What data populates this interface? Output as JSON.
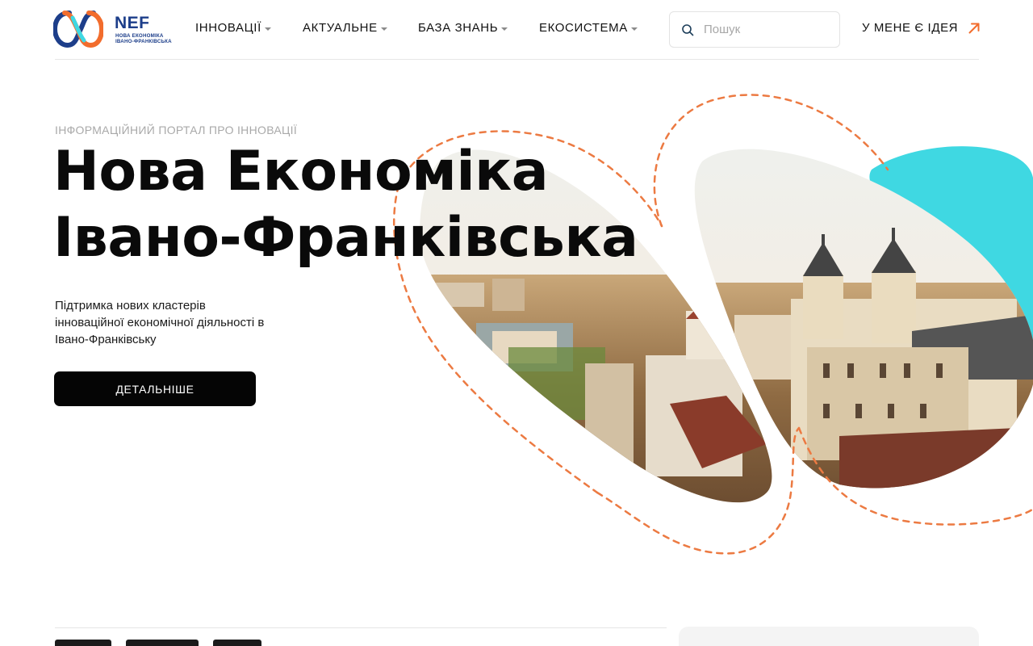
{
  "header": {
    "logo": {
      "brand": "NEF",
      "subtitle_line1": "НОВА ЕКОНОМІКА",
      "subtitle_line2": "ІВАНО-ФРАНКІВСЬКА"
    },
    "nav": [
      {
        "label": "ІННОВАЦІЇ",
        "has_dropdown": true
      },
      {
        "label": "АКТУАЛЬНЕ",
        "has_dropdown": true
      },
      {
        "label": "БАЗА ЗНАНЬ",
        "has_dropdown": true
      },
      {
        "label": "ЕКОСИСТЕМА",
        "has_dropdown": true
      }
    ],
    "search": {
      "placeholder": "Пошук",
      "value": "",
      "icon": "search-icon"
    },
    "idea_link": {
      "label": "У МЕНЕ Є ІДЕЯ",
      "icon": "arrow-up-right-icon"
    }
  },
  "hero": {
    "eyebrow": "ІНФОРМАЦІЙНИЙ ПОРТАЛ ПРО ІННОВАЦІЇ",
    "title_line1": "Нова Економіка",
    "title_line2": "Івано-Франківська",
    "lead": "Підтримка нових кластерів інноваційної економічної діяльності в Івано-Франківську",
    "cta_label": "ДЕТАЛЬНІШЕ"
  },
  "colors": {
    "brand_blue": "#1d3e8a",
    "brand_orange": "#f26d2d",
    "accent_cyan": "#3fd8e2",
    "dash_orange": "#ec7a42",
    "text": "#0a0a0a",
    "muted": "#a9a9a9",
    "button": "#050505"
  }
}
